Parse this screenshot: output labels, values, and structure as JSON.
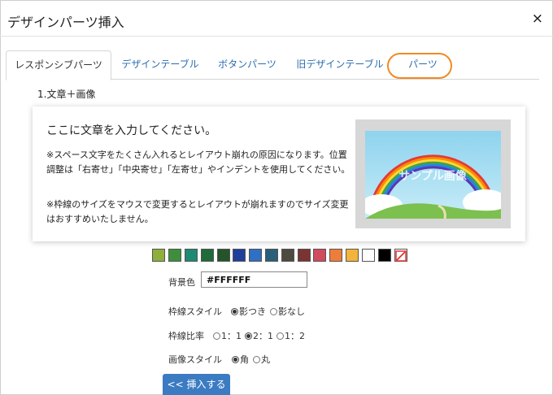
{
  "dialog": {
    "title": "デザインパーツ挿入",
    "close_label": "×"
  },
  "tabs": [
    {
      "label": "レスポンシブパーツ",
      "active": true
    },
    {
      "label": "デザインテーブル",
      "active": false
    },
    {
      "label": "ボタンパーツ",
      "active": false
    },
    {
      "label": "旧デザインテーブル",
      "active": false
    },
    {
      "label": "パーツ",
      "active": false,
      "highlighted": true
    }
  ],
  "section": {
    "label": "1.文章＋画像"
  },
  "preview": {
    "heading": "ここに文章を入力してください。",
    "paragraph1": "※スペース文字をたくさん入れるとレイアウト崩れの原因になります。位置調整は「右寄せ」「中央寄せ」「左寄せ」やインデントを使用してください。",
    "paragraph2": "※枠線のサイズをマウスで変更するとレイアウトが崩れますのでサイズ変更はおすすめいたしません。",
    "image_text": "サンプル画像"
  },
  "palette": {
    "colors": [
      "#8fae3c",
      "#3d8f3c",
      "#1d8a73",
      "#1f6b3a",
      "#25542a",
      "#1f3f9c",
      "#2f6fc4",
      "#2a5f7a",
      "#4d4a3f",
      "#7a3434",
      "#d04b5d",
      "#ef7d3a",
      "#f2b43a",
      "#ffffff",
      "#000000",
      "none"
    ]
  },
  "form": {
    "bg_label": "背景色",
    "bg_value": "#FFFFFF",
    "border_style_label": "枠線スタイル",
    "border_style_options": [
      {
        "label": "影つき",
        "checked": true
      },
      {
        "label": "影なし",
        "checked": false
      }
    ],
    "ratio_label": "枠線比率",
    "ratio_options": [
      {
        "label": "1：1",
        "checked": false
      },
      {
        "label": "2：1",
        "checked": true
      },
      {
        "label": "1：2",
        "checked": false
      }
    ],
    "image_style_label": "画像スタイル",
    "image_style_options": [
      {
        "label": "角",
        "checked": true
      },
      {
        "label": "丸",
        "checked": false
      }
    ]
  },
  "insert_button": {
    "label": "<< 挿入する"
  }
}
